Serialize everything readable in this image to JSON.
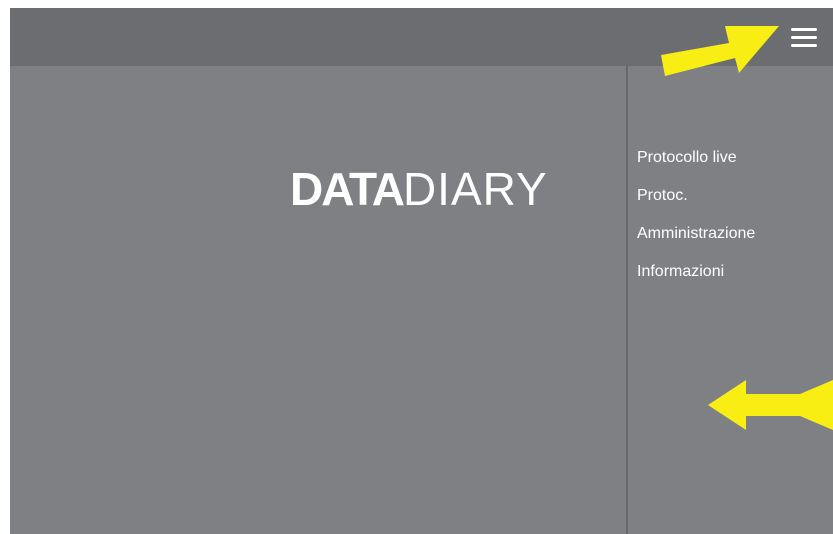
{
  "app": {
    "logo": {
      "bold": "DATA",
      "thin": "DIARY"
    }
  },
  "topbar": {
    "menu_icon": "hamburger-menu-icon"
  },
  "side_menu": {
    "items": [
      {
        "label": "Protocollo live"
      },
      {
        "label": "Protoc."
      },
      {
        "label": "Amministrazione"
      },
      {
        "label": "Informazioni"
      }
    ]
  },
  "annotations": {
    "arrow_color": "#f8ee14",
    "arrow_1_icon": "arrow-right-icon",
    "arrow_2_icon": "arrow-left-icon"
  },
  "colors": {
    "topbar": "#6c6d70",
    "content": "#7f8083",
    "divider": "#67686b",
    "text": "#ffffff"
  }
}
